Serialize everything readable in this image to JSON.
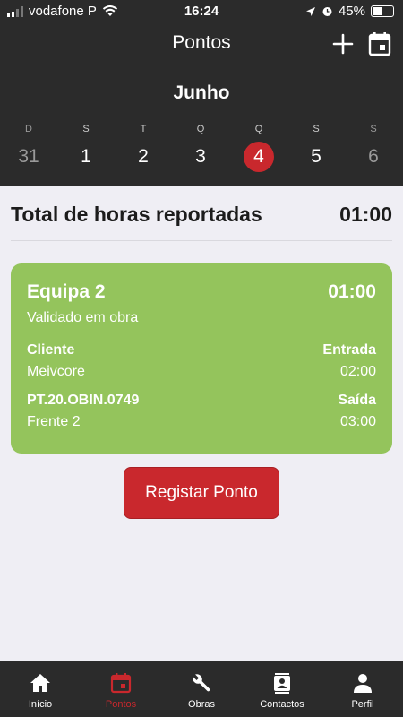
{
  "status_bar": {
    "carrier": "vodafone P",
    "time": "16:24",
    "battery": "45%"
  },
  "header": {
    "title": "Pontos",
    "icons": [
      "plus-icon",
      "calendar-icon"
    ]
  },
  "calendar": {
    "month": "Junho",
    "days": [
      {
        "weekday": "D",
        "day": "31"
      },
      {
        "weekday": "S",
        "day": "1"
      },
      {
        "weekday": "T",
        "day": "2"
      },
      {
        "weekday": "Q",
        "day": "3"
      },
      {
        "weekday": "Q",
        "day": "4"
      },
      {
        "weekday": "S",
        "day": "5"
      },
      {
        "weekday": "S",
        "day": "6"
      }
    ],
    "accent_color": "#c9282d"
  },
  "total": {
    "label": "Total de horas reportadas",
    "value": "01:00"
  },
  "card": {
    "team": "Equipa 2",
    "hours": "01:00",
    "status": "Validado em obra",
    "client_label": "Cliente",
    "client_value": "Meivcore",
    "entry_label": "Entrada",
    "entry_value": "02:00",
    "project_code": "PT.20.OBIN.0749",
    "project_front": "Frente 2",
    "exit_label": "Saída",
    "exit_value": "03:00",
    "color": "#94c45c"
  },
  "register_button": "Registar Ponto",
  "nav": {
    "items": [
      {
        "label": "Início",
        "icon": "home-icon"
      },
      {
        "label": "Pontos",
        "icon": "calendar-icon"
      },
      {
        "label": "Obras",
        "icon": "wrench-icon"
      },
      {
        "label": "Contactos",
        "icon": "contacts-icon"
      },
      {
        "label": "Perfil",
        "icon": "person-icon"
      }
    ]
  }
}
